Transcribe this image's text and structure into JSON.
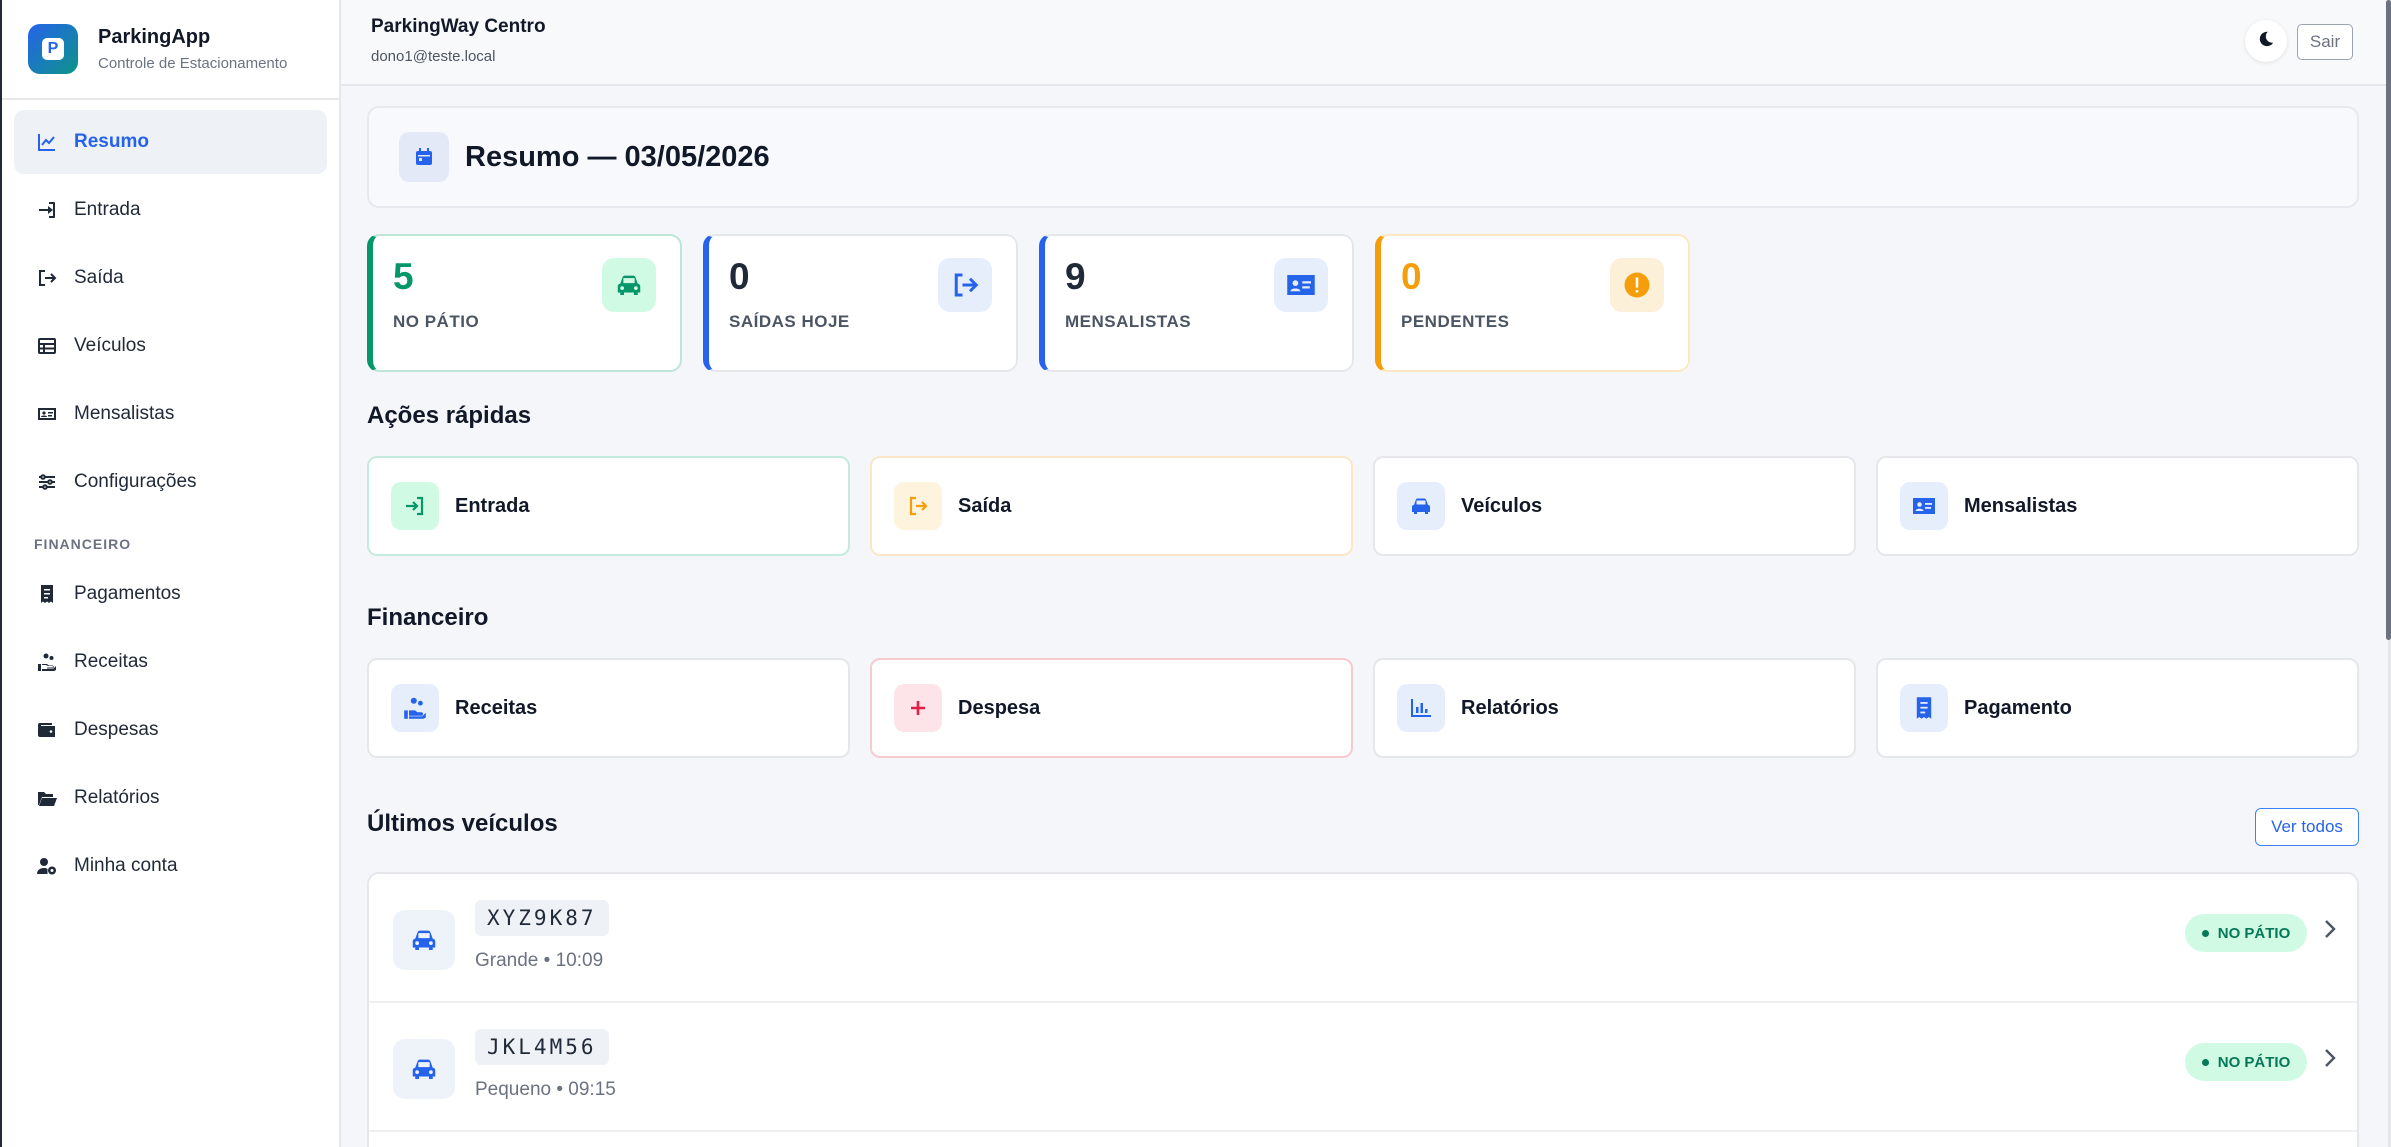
{
  "app": {
    "name": "ParkingApp",
    "subtitle": "Controle de Estacionamento",
    "logo_letter": "P"
  },
  "sidebar": {
    "items": [
      {
        "label": "Resumo",
        "icon": "chart-line-icon",
        "active": true
      },
      {
        "label": "Entrada",
        "icon": "sign-in-icon"
      },
      {
        "label": "Saída",
        "icon": "sign-out-icon"
      },
      {
        "label": "Veículos",
        "icon": "table-icon"
      },
      {
        "label": "Mensalistas",
        "icon": "id-card-icon"
      },
      {
        "label": "Configurações",
        "icon": "sliders-icon"
      }
    ],
    "finance_section": "FINANCEIRO",
    "finance_items": [
      {
        "label": "Pagamentos",
        "icon": "receipt-icon"
      },
      {
        "label": "Receitas",
        "icon": "hand-coins-icon"
      },
      {
        "label": "Despesas",
        "icon": "wallet-icon"
      },
      {
        "label": "Relatórios",
        "icon": "folder-open-icon"
      },
      {
        "label": "Minha conta",
        "icon": "user-gear-icon"
      }
    ]
  },
  "topbar": {
    "title": "ParkingWay Centro",
    "user": "dono1@teste.local",
    "theme_icon": "moon-icon",
    "logout_label": "Sair"
  },
  "header": {
    "title": "Resumo — 03/05/2026",
    "icon": "calendar-icon"
  },
  "stats": [
    {
      "value": "5",
      "label": "NO PÁTIO",
      "color": "#059669",
      "icon": "car-icon"
    },
    {
      "value": "0",
      "label": "SAÍDAS HOJE",
      "color": "#1f2937",
      "icon": "exit-icon"
    },
    {
      "value": "9",
      "label": "MENSALISTAS",
      "color": "#1f2937",
      "icon": "id-card-icon"
    },
    {
      "value": "0",
      "label": "PENDENTES",
      "color": "#f59e0b",
      "icon": "alert-icon"
    }
  ],
  "quick_actions": {
    "title": "Ações rápidas",
    "items": [
      {
        "label": "Entrada",
        "icon": "sign-in-icon"
      },
      {
        "label": "Saída",
        "icon": "sign-out-icon"
      },
      {
        "label": "Veículos",
        "icon": "car-icon"
      },
      {
        "label": "Mensalistas",
        "icon": "id-card-icon"
      }
    ]
  },
  "finance": {
    "title": "Financeiro",
    "items": [
      {
        "label": "Receitas",
        "icon": "hand-coins-icon"
      },
      {
        "label": "Despesa",
        "icon": "plus-icon"
      },
      {
        "label": "Relatórios",
        "icon": "bar-chart-icon"
      },
      {
        "label": "Pagamento",
        "icon": "receipt-icon"
      }
    ]
  },
  "vehicles": {
    "title": "Últimos veículos",
    "see_all": "Ver todos",
    "rows": [
      {
        "plate": "XYZ9K87",
        "meta": "Grande • 10:09",
        "status": "NO PÁTIO"
      },
      {
        "plate": "JKL4M56",
        "meta": "Pequeno • 09:15",
        "status": "NO PÁTIO"
      }
    ]
  }
}
